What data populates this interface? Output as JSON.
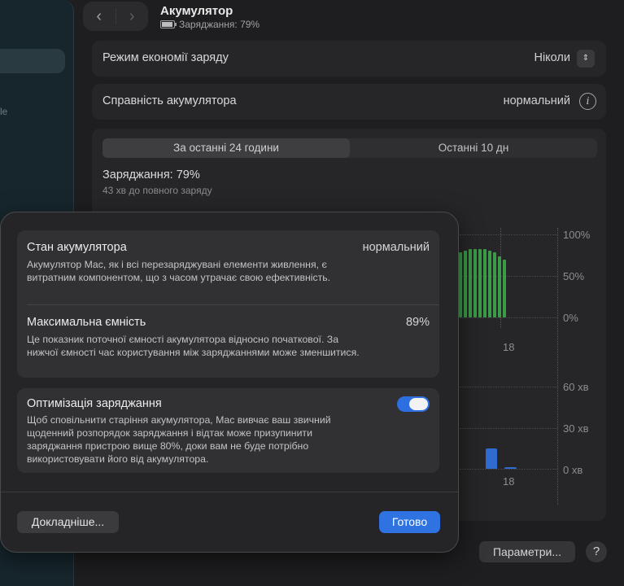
{
  "window": {
    "title": "Акумулятор",
    "subtitle": "Заряджання: 79%",
    "battery_level": 79,
    "sidebar_fragment": "le"
  },
  "settings": {
    "low_power": {
      "label": "Режим економії заряду",
      "value": "Ніколи"
    },
    "health": {
      "label": "Справність акумулятора",
      "value": "нормальний"
    }
  },
  "usage": {
    "tabs": [
      "За останні 24 години",
      "Останні 10 дн"
    ],
    "selected_tab": 0,
    "charge_title": "Заряджання: 79%",
    "charge_sub": "43 хв до повного заряду",
    "level_axis": [
      "100%",
      "50%",
      "0%"
    ],
    "level_bars_percent": [
      78,
      80,
      82,
      82,
      82,
      82,
      80,
      78,
      74,
      70
    ],
    "time_axis": [
      "60 хв",
      "30 хв",
      "0 хв"
    ],
    "screen_on_minutes": [
      15,
      1
    ],
    "x_tick": "18",
    "x_tick2": "18",
    "colors": {
      "level": "#3b9c47",
      "usage": "#2f6bd1"
    }
  },
  "footer": {
    "options_label": "Параметри...",
    "help_label": "?"
  },
  "sheet": {
    "state": {
      "title": "Стан акумулятора",
      "value": "нормальний",
      "desc": "Акумулятор Mac, як і всі перезаряджувані елементи живлення, є витратним компонентом, що з часом утрачає свою ефективність."
    },
    "capacity": {
      "title": "Максимальна ємність",
      "value": "89%",
      "desc": "Це показник поточної ємності акумулятора відносно початкової. За нижчої ємності час користування між заряджаннями може зменшитися."
    },
    "optimization": {
      "title": "Оптимізація заряджання",
      "enabled": true,
      "desc": "Щоб сповільнити старіння акумулятора, Mac вивчає ваш звичний щоденний розпорядок заряджання і відтак може призупинити заряджання пристрою вище 80%, доки вам не буде потрібно використовувати його від акумулятора."
    },
    "more_label": "Докладніше...",
    "done_label": "Готово"
  }
}
